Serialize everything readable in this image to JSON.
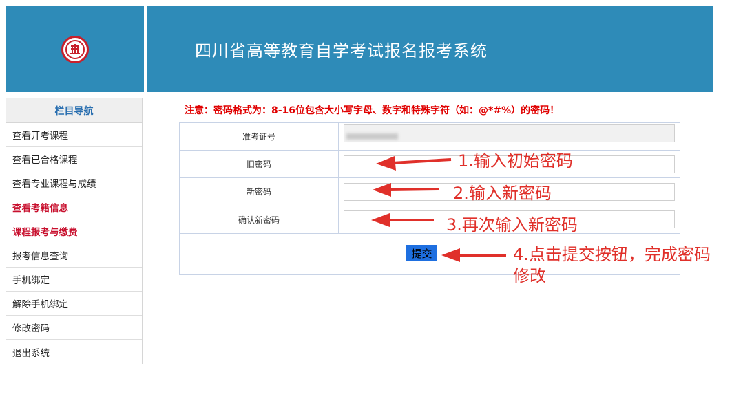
{
  "header": {
    "title": "四川省高等教育自学考试报名报考系统"
  },
  "sidebar": {
    "heading": "栏目导航",
    "items": [
      {
        "label": "查看开考课程",
        "highlight": false
      },
      {
        "label": "查看已合格课程",
        "highlight": false
      },
      {
        "label": "查看专业课程与成绩",
        "highlight": false
      },
      {
        "label": "查看考籍信息",
        "highlight": true
      },
      {
        "label": "课程报考与缴费",
        "highlight": true
      },
      {
        "label": "报考信息查询",
        "highlight": false
      },
      {
        "label": "手机绑定",
        "highlight": false
      },
      {
        "label": "解除手机绑定",
        "highlight": false
      },
      {
        "label": "修改密码",
        "highlight": false
      },
      {
        "label": "退出系统",
        "highlight": false
      }
    ]
  },
  "notice": "注意：密码格式为：8-16位包含大小写字母、数字和特殊字符（如：@*#%）的密码！",
  "form": {
    "exam_id_label": "准考证号",
    "old_password_label": "旧密码",
    "new_password_label": "新密码",
    "confirm_password_label": "确认新密码",
    "submit_label": "提交"
  },
  "annotations": {
    "step1": "1.输入初始密码",
    "step2": "2.输入新密码",
    "step3": "3.再次输入新密码",
    "step4": "4.点击提交按钮，完成密码修改"
  },
  "colors": {
    "header_bg": "#2e8bb8",
    "notice": "#e00000",
    "annotation": "#e0302a",
    "submit_bg": "#1e6fe0",
    "nav_heading": "#2a6fb0",
    "nav_highlight": "#c8102e"
  }
}
